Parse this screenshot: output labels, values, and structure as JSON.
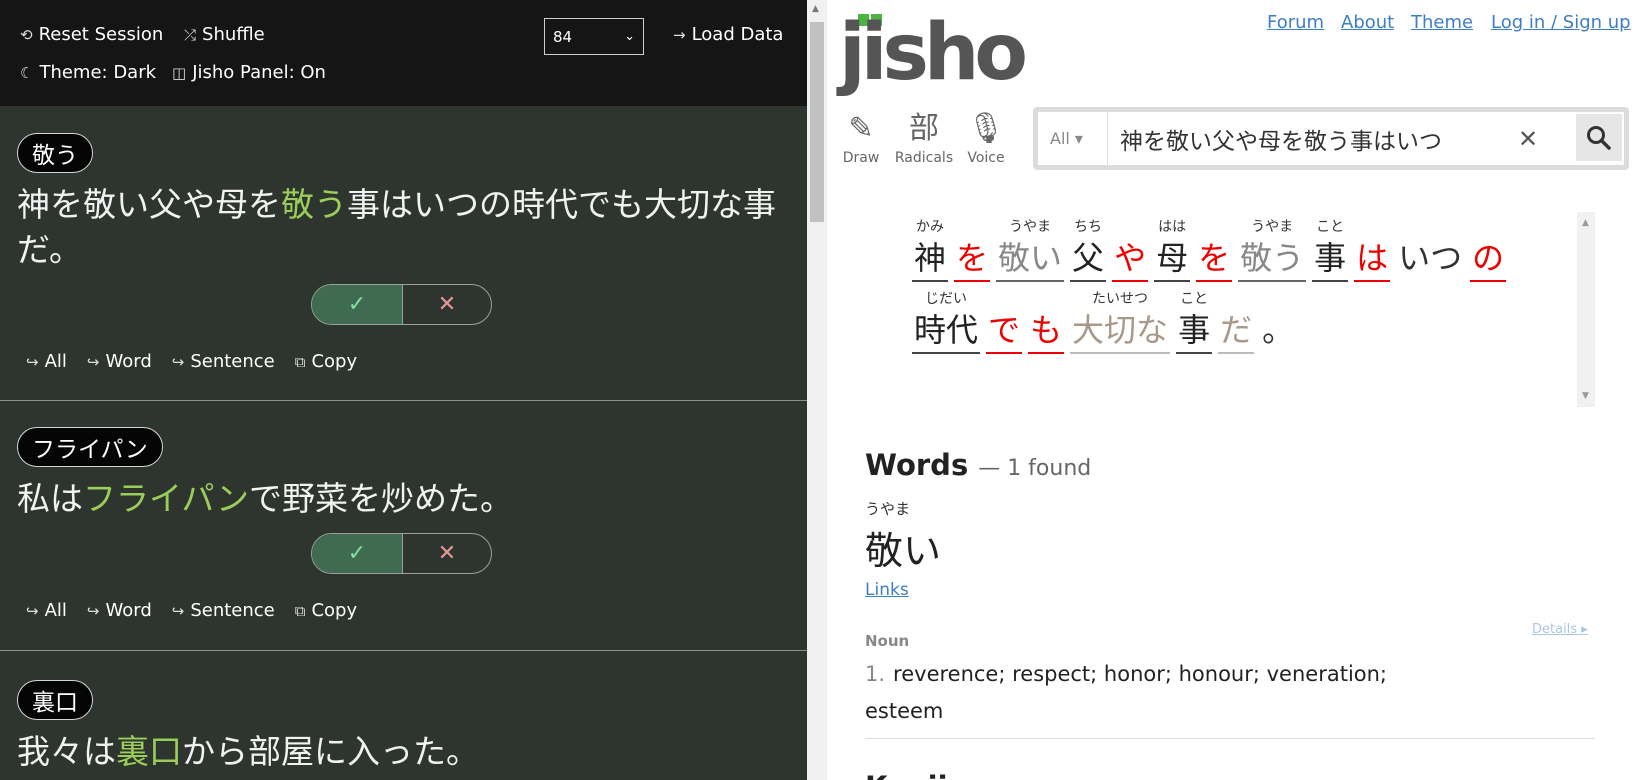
{
  "toolbar": {
    "reset_label": "Reset Session",
    "shuffle_label": "Shuffle",
    "deck_value": "84",
    "load_label": "Load Data",
    "theme_label": "Theme: Dark",
    "panel_label": "Jisho Panel: On"
  },
  "cards": [
    {
      "word": "敬う",
      "sentence_pre": "神を敬い父や母を",
      "sentence_hl": "敬う",
      "sentence_post": "事はいつの時代でも大切な事だ。",
      "yes_symbol": "✓",
      "no_symbol": "✕",
      "actions": [
        "All",
        "Word",
        "Sentence",
        "Copy"
      ]
    },
    {
      "word": "フライパン",
      "sentence_pre": "私は",
      "sentence_hl": "フライパン",
      "sentence_post": "で野菜を炒めた。",
      "yes_symbol": "✓",
      "no_symbol": "✕",
      "actions": [
        "All",
        "Word",
        "Sentence",
        "Copy"
      ]
    },
    {
      "word": "裏口",
      "sentence_pre": "我々は",
      "sentence_hl": "裏口",
      "sentence_post": "から部屋に入った。"
    }
  ],
  "jisho": {
    "logo_text": "jisho",
    "nav": [
      "Forum",
      "About",
      "Theme",
      "Log in / Sign up"
    ],
    "tools": [
      {
        "icon": "✎",
        "label": "Draw"
      },
      {
        "icon": "部",
        "label": "Radicals"
      },
      {
        "icon": "🎙",
        "label": "Voice"
      }
    ],
    "search_filter": "All ▾",
    "search_query": "神を敬い父や母を敬う事はいつ",
    "clear_symbol": "✕",
    "sentence_row1": [
      {
        "furi": "かみ",
        "base": "神",
        "style": "black"
      },
      {
        "furi": "",
        "base": "を",
        "style": "red"
      },
      {
        "furi": "うやま",
        "base": "敬い",
        "style": "gray"
      },
      {
        "furi": "ちち",
        "base": "父",
        "style": "black"
      },
      {
        "furi": "",
        "base": "や",
        "style": "red"
      },
      {
        "furi": "はは",
        "base": "母",
        "style": "black"
      },
      {
        "furi": "",
        "base": "を",
        "style": "red"
      },
      {
        "furi": "うやま",
        "base": "敬う",
        "style": "gray"
      },
      {
        "furi": "こと",
        "base": "事",
        "style": "black"
      },
      {
        "furi": "",
        "base": "は",
        "style": "red"
      },
      {
        "furi": "",
        "base": "いつ",
        "style": "plain"
      },
      {
        "furi": "",
        "base": "の",
        "style": "red"
      }
    ],
    "sentence_row2": [
      {
        "furi": "じだい",
        "base": "時代",
        "style": "black"
      },
      {
        "furi": "",
        "base": "で",
        "style": "red"
      },
      {
        "furi": "",
        "base": "も",
        "style": "red"
      },
      {
        "furi": "たいせつ",
        "base": "大切な",
        "style": "lightbrown"
      },
      {
        "furi": "こと",
        "base": "事",
        "style": "black"
      },
      {
        "furi": "",
        "base": "だ",
        "style": "lightbrown"
      },
      {
        "furi": "",
        "base": "。",
        "style": "plain"
      }
    ],
    "words_heading": "Words",
    "words_count": "— 1 found",
    "word_furigana": "うやま",
    "word_main": "敬い",
    "links_label": "Links",
    "details_label": "Details ▸",
    "pos": "Noun",
    "meaning_num": "1.",
    "meaning_text": "reverence; respect; honor; honour; veneration; esteem",
    "next_heading": "Kanji"
  }
}
